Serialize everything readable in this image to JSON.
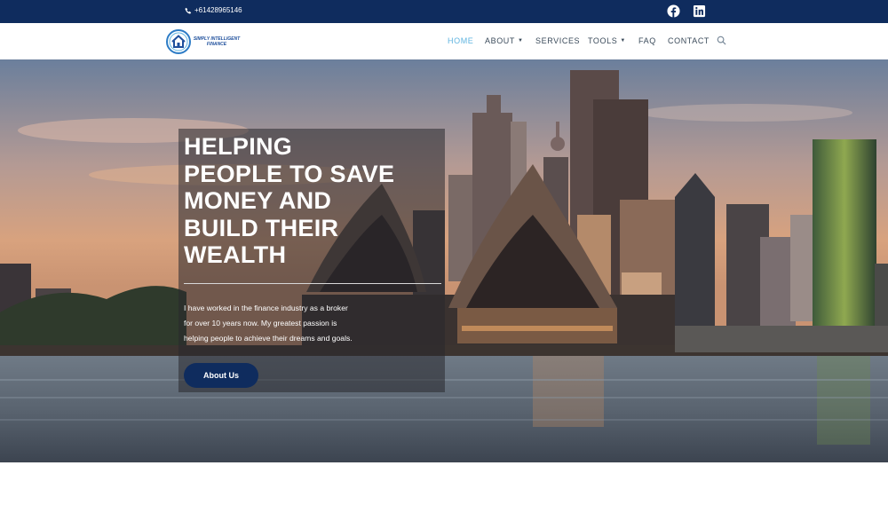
{
  "topbar": {
    "phone": "+61428965146",
    "social": [
      "facebook-icon",
      "linkedin-icon"
    ]
  },
  "logo": {
    "text": "SIMPLY INTELLIGENT FINANCE"
  },
  "nav": {
    "items": [
      {
        "label": "HOME",
        "active": true
      },
      {
        "label": "ABOUT",
        "dropdown": true
      },
      {
        "label": "SERVICES"
      },
      {
        "label": "TOOLS",
        "dropdown": true
      },
      {
        "label": "FAQ"
      },
      {
        "label": "CONTACT"
      }
    ]
  },
  "hero": {
    "headline": "HELPING\nPEOPLE TO SAVE\nMONEY AND\nBUILD THEIR\nWEALTH",
    "body": "I have worked in the finance industry as a broker\nfor over 10 years now. My greatest passion is\nhelping people to achieve their dreams and goals.",
    "button": "About Us"
  },
  "colors": {
    "topbar": "#0f2c5e",
    "active_nav": "#5fb4e0",
    "button": "#0f2c5e"
  }
}
